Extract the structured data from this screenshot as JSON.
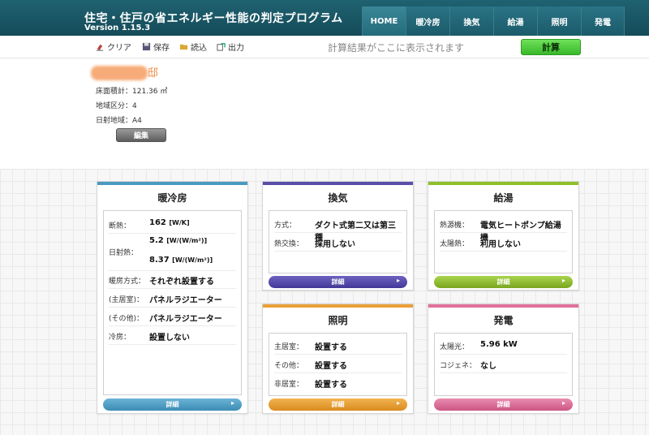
{
  "app": {
    "title": "住宅・住戸の省エネルギー性能の判定プログラム",
    "version": "Version 1.15.3"
  },
  "nav": [
    {
      "label": "HOME"
    },
    {
      "label": "暖冷房"
    },
    {
      "label": "換気"
    },
    {
      "label": "給湯"
    },
    {
      "label": "照明"
    },
    {
      "label": "発電"
    }
  ],
  "toolbar": {
    "clear": "クリア",
    "save": "保存",
    "load": "読込",
    "output": "出力",
    "status": "計算結果がここに表示されます",
    "calc": "計算"
  },
  "house": {
    "name_suffix": "邸",
    "floor_area": "床面積計：121.36 ㎡",
    "region": "地域区分：4",
    "solar_region": "日射地域：A4",
    "edit": "編集"
  },
  "colors": {
    "heating": "#4a9ac0",
    "ventilation": "#5a4fa8",
    "hotwater": "#8fbf2a",
    "lighting": "#eaa038",
    "generation": "#e0709a"
  },
  "cards": {
    "heating": {
      "title": "暖冷房",
      "insulation_label": "断熱：",
      "insulation_value": "162",
      "insulation_unit": "[W/K]",
      "solar_label": "日射熱：",
      "solar_value1": "5.2",
      "solar_unit1": "[W/(W/m²)]",
      "solar_value2": "8.37",
      "solar_unit2": "[W/(W/m²)]",
      "method_label": "暖房方式：",
      "method_value": "それぞれ設置する",
      "main_label": "(主居室)：",
      "main_value": "パネルラジエーター",
      "other_label": "(その他)：",
      "other_value": "パネルラジエーター",
      "cooling_label": "冷房：",
      "cooling_value": "設置しない",
      "detail": "詳細"
    },
    "ventilation": {
      "title": "換気",
      "method_label": "方式：",
      "method_value": "ダクト式第二又は第三種",
      "exchange_label": "熱交換：",
      "exchange_value": "採用しない",
      "detail": "詳細"
    },
    "hotwater": {
      "title": "給湯",
      "heater_label": "熱源機：",
      "heater_value": "電気ヒートポンプ給湯機",
      "solar_label": "太陽熱：",
      "solar_value": "利用しない",
      "detail": "詳細"
    },
    "lighting": {
      "title": "照明",
      "main_label": "主居室：",
      "main_value": "設置する",
      "other_label": "その他：",
      "other_value": "設置する",
      "nonliving_label": "非居室：",
      "nonliving_value": "設置する",
      "detail": "詳細"
    },
    "generation": {
      "title": "発電",
      "pv_label": "太陽光：",
      "pv_value": "5.96 kW",
      "cogen_label": "コジェネ：",
      "cogen_value": "なし",
      "detail": "詳細"
    }
  }
}
